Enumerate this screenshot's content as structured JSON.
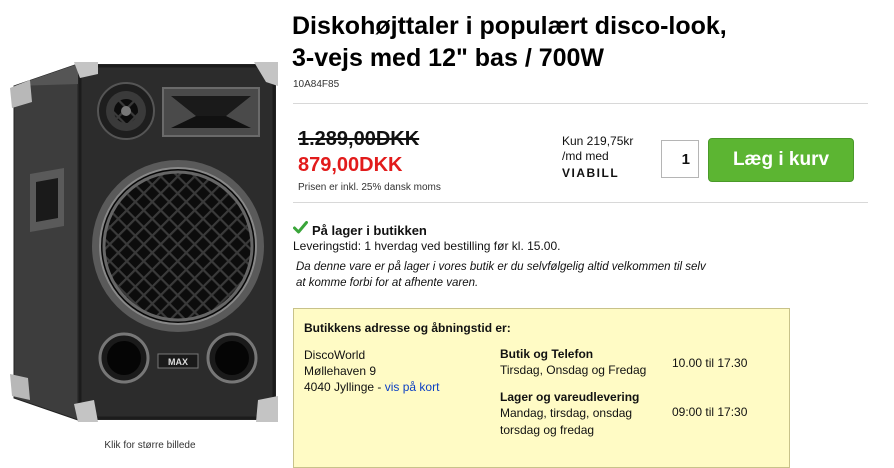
{
  "product": {
    "title_line1": "Diskohøjttaler i populært disco-look,",
    "title_line2": "3-vejs med 12\" bas / 700W",
    "sku": "10A84F85",
    "image_caption": "Klik for større billede",
    "speaker_brand": "MAX"
  },
  "pricing": {
    "old_price": "1.289,00DKK",
    "new_price": "879,00DKK",
    "vat_note": "Prisen er inkl. 25% dansk moms",
    "viabill_line1": "Kun 219,75kr",
    "viabill_line2": "/md med",
    "viabill_logo": "VIABILL",
    "quantity": "1",
    "add_to_cart_label": "Læg i kurv"
  },
  "stock": {
    "status": "På lager i butikken",
    "delivery_time": "Leveringstid: 1 hverdag ved bestilling før kl. 15.00.",
    "note_line1": "Da denne vare er på lager i vores butik er du selvfølgelig altid velkommen til selv",
    "note_line2": "at komme forbi for at afhente varen."
  },
  "store": {
    "heading": "Butikkens adresse og åbningstid er:",
    "name": "DiscoWorld",
    "street": "Møllehaven 9",
    "city": "4040 Jyllinge - ",
    "map_link": "vis på kort",
    "shop_heading": "Butik og Telefon",
    "shop_days": "Tirsdag, Onsdag og Fredag",
    "shop_hours": "10.00 til 17.30",
    "warehouse_heading": "Lager og vareudlevering",
    "warehouse_days_line1": "Mandag, tirsdag, onsdag",
    "warehouse_days_line2": "torsdag og fredag",
    "warehouse_hours": "09:00 til 17:30"
  },
  "colors": {
    "sale_price": "#e21b1b",
    "cart_button": "#5cb532",
    "check_icon": "#3aa53a",
    "info_box": "#fffbc5",
    "link": "#0b3fc4"
  }
}
